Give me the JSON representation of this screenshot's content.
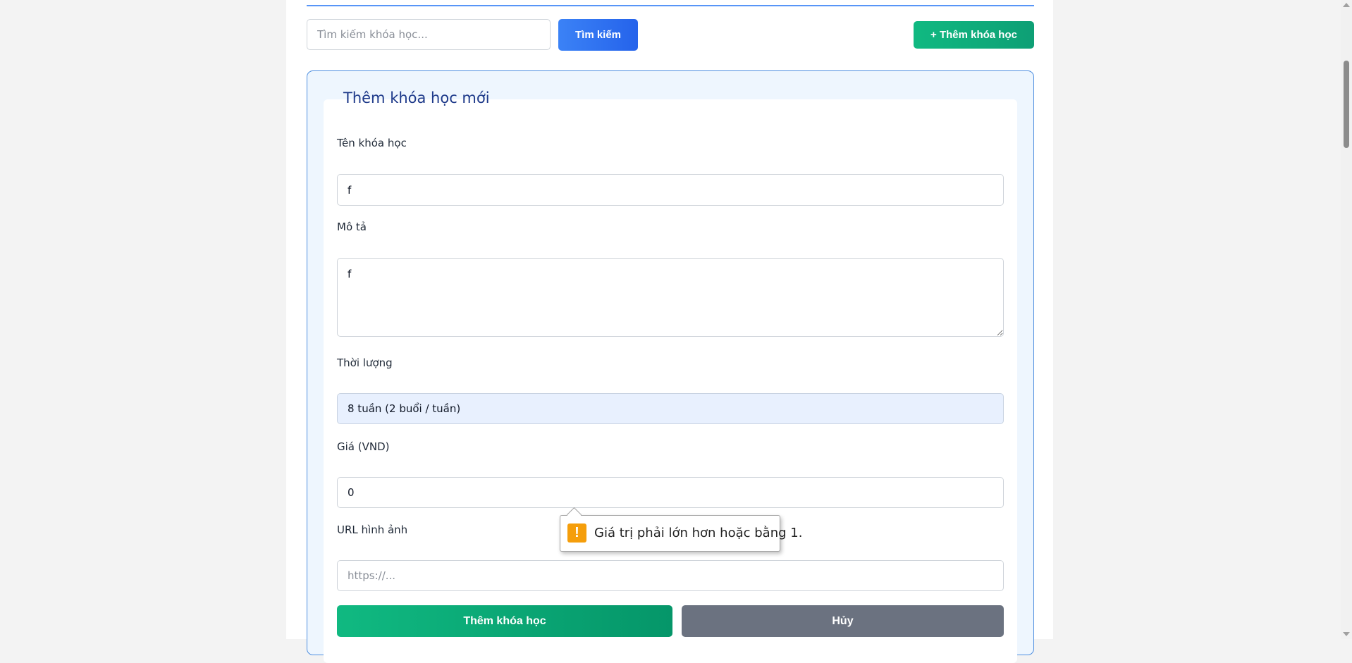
{
  "toolbar": {
    "search_placeholder": "Tìm kiếm khóa học...",
    "search_label": "Tìm kiếm",
    "add_label": "+ Thêm khóa học"
  },
  "form": {
    "title": "Thêm khóa học mới",
    "name_label": "Tên khóa học",
    "name_value": "f",
    "description_label": "Mô tả",
    "description_value": "f",
    "duration_label": "Thời lượng",
    "duration_value": "8 tuần (2 buổi / tuần)",
    "price_label": "Giá (VND)",
    "price_value": "0",
    "image_label": "URL hình ảnh",
    "image_placeholder": "https://...",
    "submit_label": "Thêm khóa học",
    "cancel_label": "Hủy"
  },
  "validation": {
    "icon": "warning-icon",
    "message": "Giá trị phải lớn hơn hoặc bằng 1."
  },
  "colors": {
    "primary": "#2563eb",
    "success": "#10b981",
    "muted": "#6b7280",
    "warning": "#f59e0b"
  }
}
